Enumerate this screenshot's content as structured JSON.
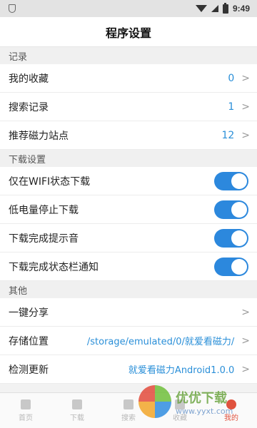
{
  "status_bar": {
    "time": "9:49"
  },
  "header": {
    "title": "程序设置"
  },
  "sections": {
    "records": {
      "title": "记录",
      "items": [
        {
          "label": "我的收藏",
          "value": "0"
        },
        {
          "label": "搜索记录",
          "value": "1"
        },
        {
          "label": "推荐磁力站点",
          "value": "12"
        }
      ]
    },
    "download": {
      "title": "下载设置",
      "items": [
        {
          "label": "仅在WIFI状态下载",
          "on": true
        },
        {
          "label": "低电量停止下载",
          "on": true
        },
        {
          "label": "下载完成提示音",
          "on": true
        },
        {
          "label": "下载完成状态栏通知",
          "on": true
        }
      ]
    },
    "other": {
      "title": "其他",
      "items": [
        {
          "label": "一键分享",
          "value": ""
        },
        {
          "label": "存储位置",
          "value": "/storage/emulated/0/就爱看磁力/"
        },
        {
          "label": "检测更新",
          "value": "就爱看磁力Android1.0.0"
        }
      ]
    }
  },
  "tab_bar": {
    "tabs": [
      {
        "label": "首页"
      },
      {
        "label": "下载"
      },
      {
        "label": "搜索"
      },
      {
        "label": "收藏"
      },
      {
        "label": "我的"
      }
    ]
  },
  "watermark": {
    "text": "优优下载",
    "url": "www.yyxt.com"
  },
  "colors": {
    "accent": "#2c88dd",
    "value_text": "#2a8fd8",
    "active_tab": "#e0523e"
  }
}
